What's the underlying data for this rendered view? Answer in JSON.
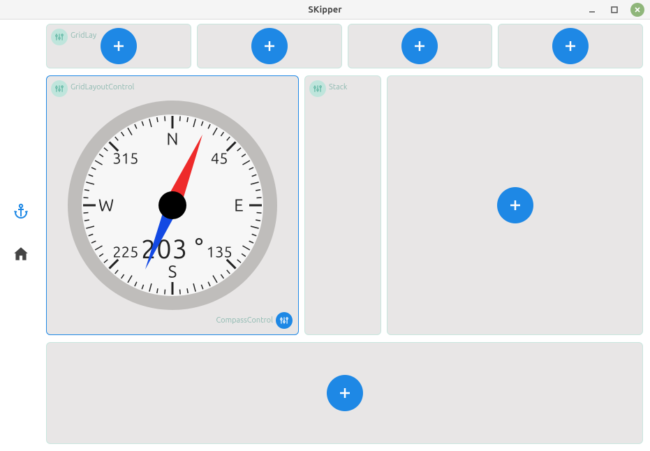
{
  "title": "SKipper",
  "sidebar": {
    "items": [
      {
        "name": "anchor",
        "active": true
      },
      {
        "name": "home",
        "active": false
      }
    ]
  },
  "topRow": {
    "panels": [
      {
        "label": "GridLay"
      },
      {
        "label": ""
      },
      {
        "label": ""
      },
      {
        "label": ""
      }
    ]
  },
  "compass": {
    "panelLabel": "GridLayoutControl",
    "controlLabel": "CompassControl",
    "heading": 203,
    "directions": {
      "n": "N",
      "e": "E",
      "s": "S",
      "w": "W"
    },
    "diagonals": {
      "ne": "45",
      "se": "135",
      "sw": "225",
      "nw": "315"
    }
  },
  "stack": {
    "label": "Stack"
  },
  "chart_data": {
    "type": "gauge",
    "title": "",
    "range": [
      0,
      360
    ],
    "value": 203,
    "unit": "°",
    "major_ticks": [
      0,
      45,
      90,
      135,
      180,
      225,
      270,
      315
    ],
    "labels": {
      "0": "N",
      "45": "45",
      "90": "E",
      "135": "135",
      "180": "S",
      "225": "225",
      "270": "W",
      "315": "315"
    }
  }
}
